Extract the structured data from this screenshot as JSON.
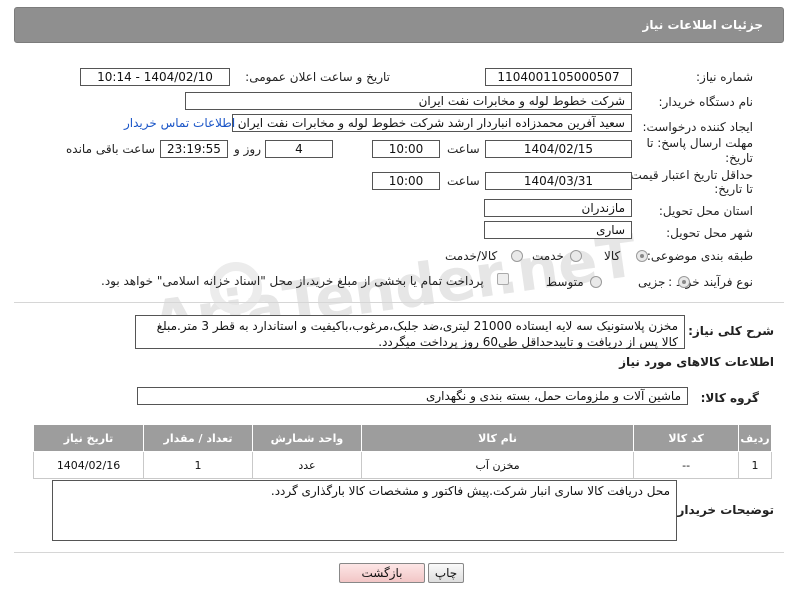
{
  "header": {
    "title": "جزئیات اطلاعات نیاز"
  },
  "watermark": {
    "text": "AriaTender.neT"
  },
  "fields": {
    "need_number_label": "شماره نیاز:",
    "need_number": "1104001105000507",
    "announce_label": "تاریخ و ساعت اعلان عمومی:",
    "announce_value": "1404/02/10 - 10:14",
    "buyer_org_label": "نام دستگاه خریدار:",
    "buyer_org": "شرکت خطوط لوله و مخابرات نفت ایران",
    "requester_label": "ایجاد کننده درخواست:",
    "requester": "سعید آفرین محمدزاده انباردار ارشد شرکت خطوط لوله و مخابرات نفت ایران",
    "buyer_contact_link": "اطلاعات تماس خریدار",
    "reply_deadline_label_1": "مهلت ارسال پاسخ: تا",
    "reply_deadline_label_2": "تاریخ:",
    "reply_date": "1404/02/15",
    "time_label": "ساعت",
    "reply_time": "10:00",
    "days_value": "4",
    "days_label": "روز و",
    "remaining_value": "23:19:55",
    "remaining_label": "ساعت باقی مانده",
    "price_validity_label_1": "حداقل تاریخ اعتبار قیمت:",
    "price_validity_label_2": "تا تاریخ:",
    "price_date": "1404/03/31",
    "price_time": "10:00",
    "province_label": "استان محل تحویل:",
    "province": "مازندران",
    "city_label": "شهر محل تحویل:",
    "city": "ساری",
    "category_label": "طبقه بندی موضوعی:",
    "category_options": [
      "کالا",
      "خدمت",
      "کالا/خدمت"
    ],
    "process_label": "نوع فرآیند خرید :",
    "process_options": [
      "جزیی",
      "متوسط"
    ],
    "treasury_note": "پرداخت تمام یا بخشی از مبلغ خرید،از محل \"اسناد خزانه اسلامی\" خواهد بود."
  },
  "description": {
    "label": "شرح کلی نیاز:",
    "text": "مخزن پلاستونیک سه لایه ایستاده 21000 لیتری،ضد جلبک،مرغوب،باکیفیت و استاندارد به قطر 3 متر.مبلغ کالا پس از دریافت و تاییدحداقل طی60 روز پرداخت میگردد."
  },
  "goods": {
    "section_title": "اطلاعات کالاهای مورد نیاز",
    "group_label": "گروه کالا:",
    "group_value": "ماشین آلات و ملزومات حمل، بسته بندی و نگهداری",
    "columns": [
      "ردیف",
      "کد کالا",
      "نام کالا",
      "واحد شمارش",
      "تعداد / مقدار",
      "تاریخ نیاز"
    ],
    "rows": [
      {
        "row": "1",
        "code": "--",
        "name": "مخزن آب",
        "unit": "عدد",
        "qty": "1",
        "date": "1404/02/16"
      }
    ]
  },
  "buyer_notes": {
    "label": "توضیحات خریدار:",
    "text": "محل دریافت کالا ساری انبار شرکت.پیش فاکتور و مشخصات کالا بارگذاری گردد."
  },
  "buttons": {
    "print": "چاپ",
    "back": "بازگشت"
  },
  "colors": {
    "header_bg": "#8f8f8f",
    "table_header_bg": "#9d9d9d",
    "link": "#1a55c7",
    "back_button": "#f2c6c6"
  }
}
